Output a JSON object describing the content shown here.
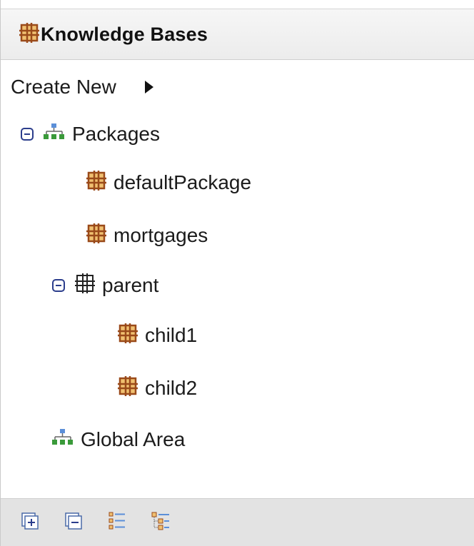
{
  "panel": {
    "title": "Knowledge Bases",
    "title_icon": "package-icon"
  },
  "create_new": {
    "label": "Create New",
    "icon": "triangle-right-icon"
  },
  "tree": {
    "packages": {
      "label": "Packages",
      "icon": "hierarchy-icon",
      "expanded": true,
      "children": {
        "default_package": {
          "label": "defaultPackage",
          "icon": "package-icon"
        },
        "mortgages": {
          "label": "mortgages",
          "icon": "package-icon"
        },
        "parent": {
          "label": "parent",
          "icon": "package-outline-icon",
          "expanded": true,
          "children": {
            "child1": {
              "label": "child1",
              "icon": "package-icon"
            },
            "child2": {
              "label": "child2",
              "icon": "package-icon"
            }
          }
        }
      }
    },
    "global_area": {
      "label": "Global Area",
      "icon": "hierarchy-icon"
    }
  },
  "footer": {
    "buttons": [
      {
        "icon": "expand-all-icon"
      },
      {
        "icon": "collapse-all-icon"
      },
      {
        "icon": "flat-view-icon"
      },
      {
        "icon": "hierarchical-view-icon"
      }
    ]
  },
  "colors": {
    "package_brown": "#9a4a1a",
    "package_fill": "#f0c070",
    "toggle_blue": "#2b3d8c",
    "hierarchy_green": "#3a9a3a",
    "hierarchy_blue": "#5b8fd8",
    "footer_bg": "#e3e3e3",
    "header_bg": "#efefef"
  }
}
